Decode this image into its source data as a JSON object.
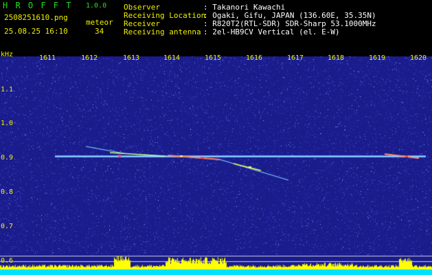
{
  "header": {
    "app_name": "H R O F F T",
    "version": "1.0.0",
    "filename": "2508251610.png",
    "meteor_label": "meteor",
    "datetime": "25.08.25 16:10",
    "meteor_count": "34",
    "info": [
      {
        "label": "Observer",
        "value": ": Takanori Kawachi"
      },
      {
        "label": "Receiving Location",
        "value": ": Ogaki, Gifu, JAPAN (136.60E, 35.35N)"
      },
      {
        "label": "Receiver",
        "value": ": R820T2(RTL-SDR) SDR-Sharp 53.1000MHz"
      },
      {
        "label": "Receiving antenna",
        "value": ": 2el-HB9CV Vertical (el. E-W)"
      }
    ]
  },
  "spectrogram": {
    "y_unit": "kHz",
    "y_ticks": [
      "1.1",
      "1.0",
      "0.9",
      "0.8",
      "0.7",
      "0.6"
    ],
    "x_ticks": [
      "1611",
      "1612",
      "1613",
      "1614",
      "1615",
      "1616",
      "1617",
      "1618",
      "1619",
      "1620"
    ],
    "colors": {
      "background": "#1a1c8c",
      "carrier": "#9ad8ff",
      "bars": "#ffff00",
      "baseline": "#00e0ff"
    }
  }
}
